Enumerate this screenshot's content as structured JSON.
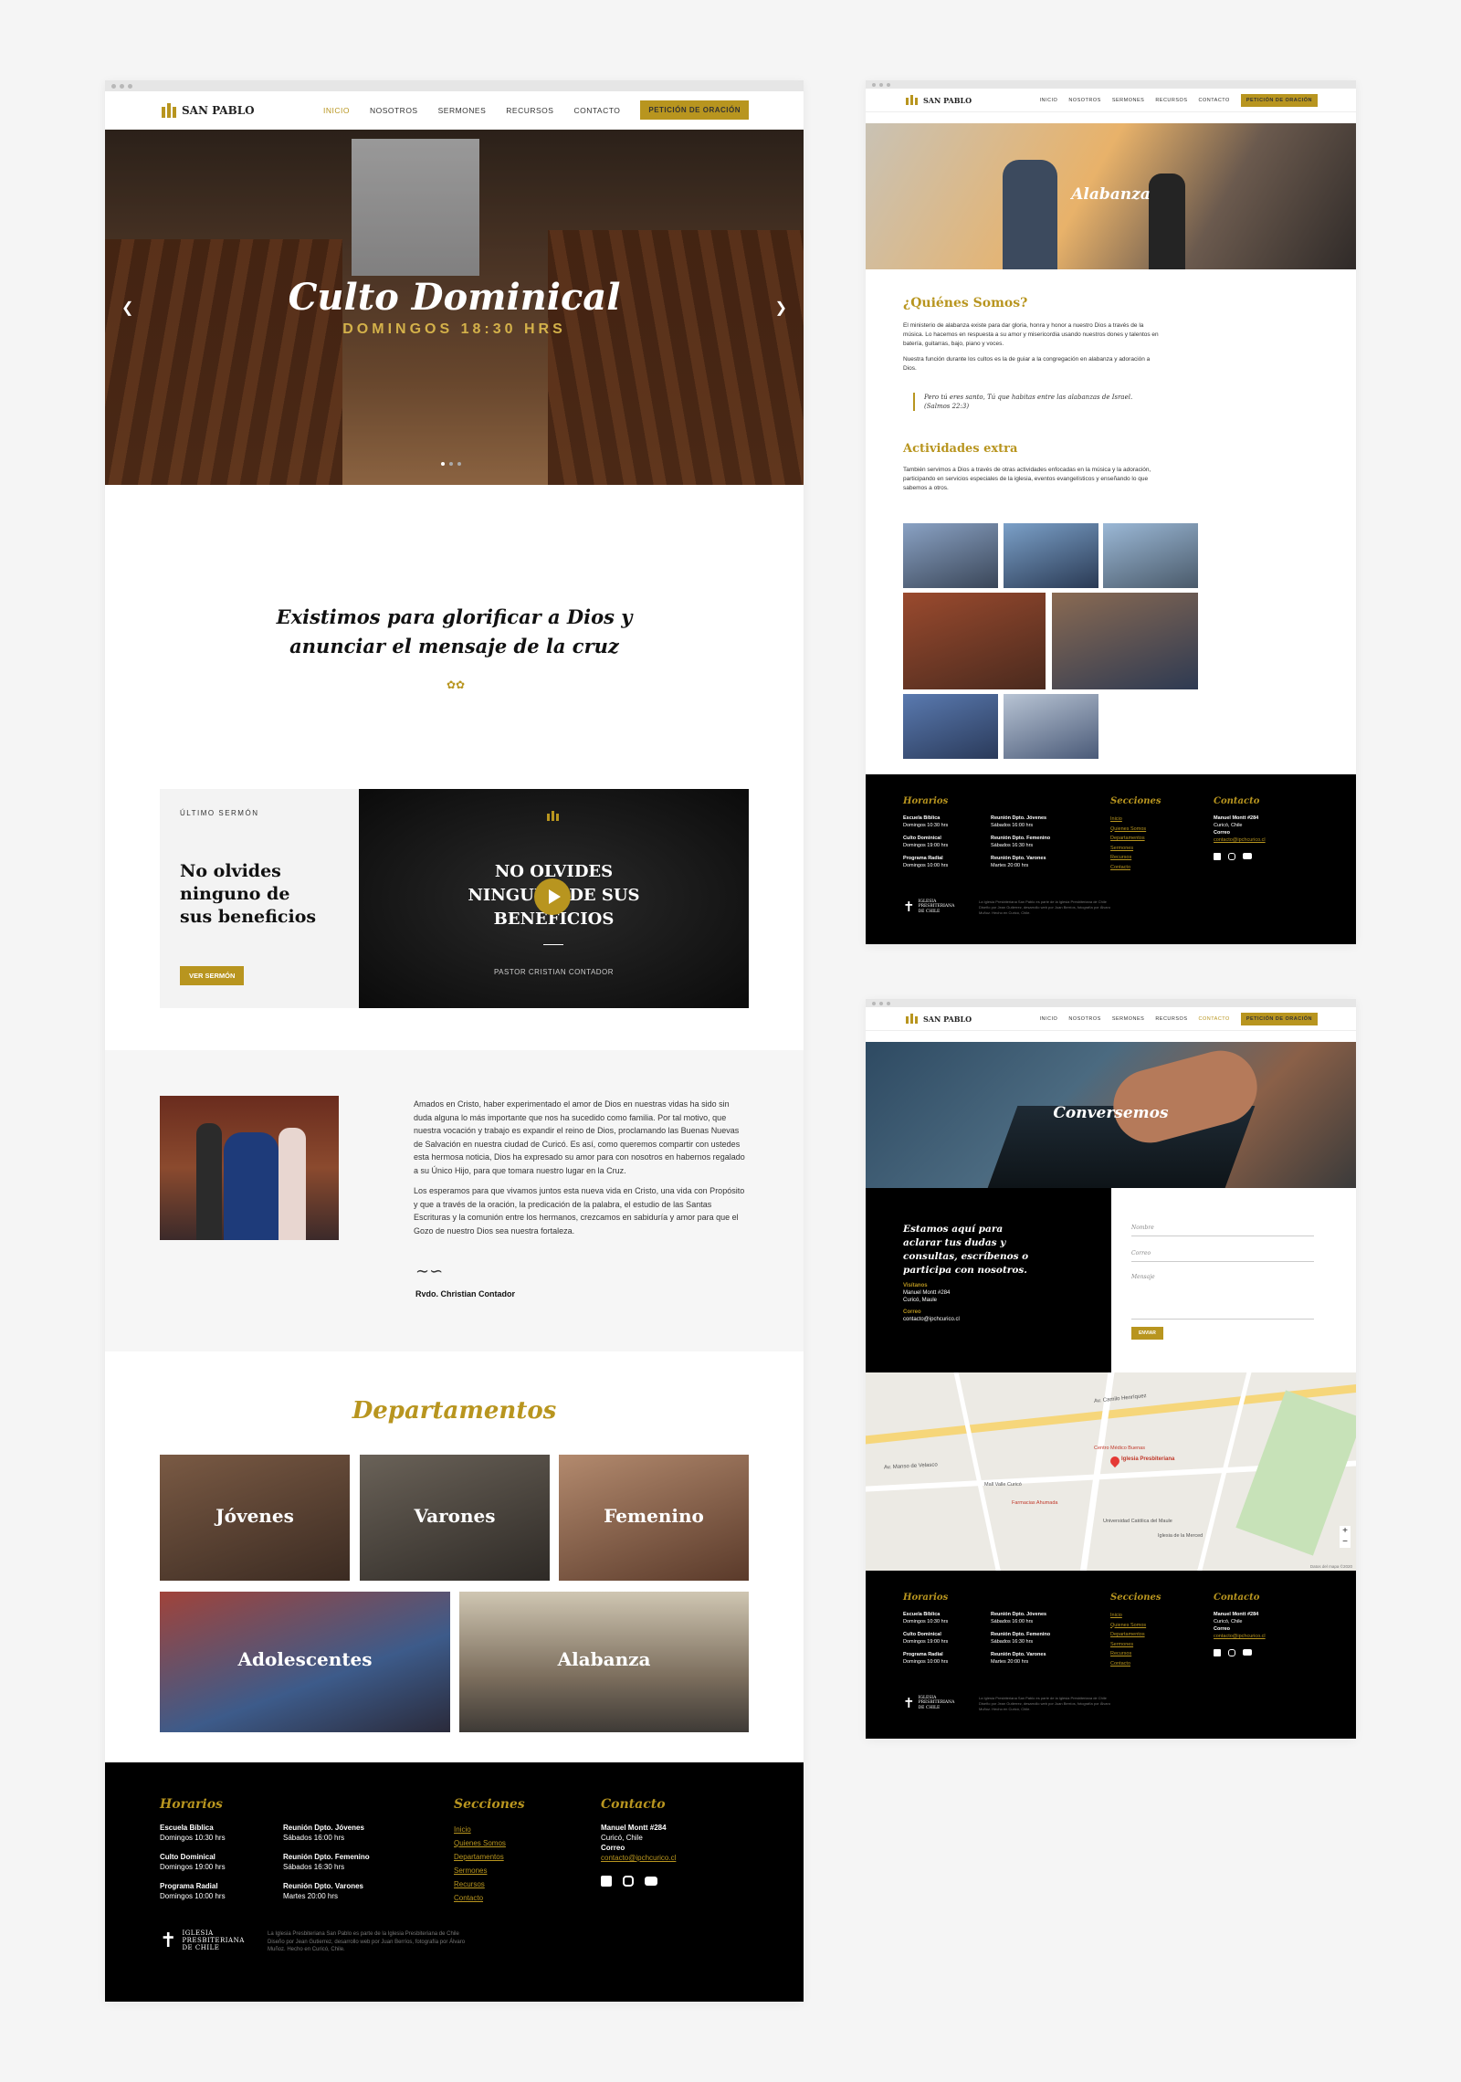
{
  "brand": {
    "name": "SAN PABLO",
    "gold": "#b8951f"
  },
  "nav": {
    "items": [
      "INICIO",
      "NOSOTROS",
      "SERMONES",
      "RECURSOS",
      "CONTACTO"
    ],
    "cta": "PETICIÓN DE ORACIÓN"
  },
  "home": {
    "hero": {
      "title": "Culto Dominical",
      "subtitle": "DOMINGOS 18:30 HRS"
    },
    "mission": {
      "line1": "Existimos para glorificar a Dios y",
      "line2": "anunciar el mensaje de la cruz"
    },
    "sermon": {
      "eyebrow": "ÚLTIMO SERMÓN",
      "title": "No olvides ninguno de sus beneficios",
      "button": "VER SERMÓN",
      "video_title_l1": "NO OLVIDES",
      "video_title_l2": "NINGUNO DE SUS",
      "video_title_l3": "BENEFICIOS",
      "video_caption": "PASTOR CRISTIAN CONTADOR"
    },
    "pastor": {
      "p1": "Amados en Cristo, haber experimentado el amor de Dios en nuestras vidas ha sido sin duda alguna lo más importante que nos ha sucedido como familia. Por tal motivo, que nuestra vocación y trabajo es expandir el reino de Dios, proclamando las Buenas Nuevas de Salvación en nuestra ciudad de Curicó. Es así, como queremos compartir con ustedes esta hermosa noticia, Dios ha expresado su amor para con nosotros en habernos regalado a su Único Hijo, para que tomara nuestro lugar en la Cruz.",
      "p2": "Los esperamos para que vivamos juntos esta nueva vida en Cristo, una vida con Propósito y que a través de la oración, la predicación de la palabra, el estudio de las Santas Escrituras y la comunión entre los hermanos, crezcamos en sabiduría y amor para que el Gozo de nuestro Dios sea nuestra fortaleza.",
      "signature": "Rvdo. Christian Contador"
    },
    "departments_title": "Departamentos",
    "departments": [
      "Jóvenes",
      "Varones",
      "Femenino",
      "Adolescentes",
      "Alabanza"
    ]
  },
  "footer": {
    "horarios_title": "Horarios",
    "schedule": [
      {
        "name": "Escuela Bíblica",
        "time": "Domingos 10:30 hrs"
      },
      {
        "name": "Culto Dominical",
        "time": "Domingos 19:00 hrs"
      },
      {
        "name": "Programa Radial",
        "time": "Domingos 10:00 hrs"
      },
      {
        "name": "Reunión Dpto. Jóvenes",
        "time": "Sábados 16:00 hrs"
      },
      {
        "name": "Reunión Dpto. Femenino",
        "time": "Sábados 16:30 hrs"
      },
      {
        "name": "Reunión Dpto. Varones",
        "time": "Martes 20:00 hrs"
      }
    ],
    "secciones_title": "Secciones",
    "sections": [
      "Inicio",
      "Quienes Somos",
      "Departamentos",
      "Sermones",
      "Recursos",
      "Contacto"
    ],
    "contacto_title": "Contacto",
    "address": "Manuel Montt #284",
    "city": "Curicó, Chile",
    "mail_label": "Correo",
    "mail": "contacto@ipchcurico.cl",
    "org_l1": "IGLESIA",
    "org_l2": "PRESBITERIANA",
    "org_l3": "DE CHILE",
    "credits_l1": "La Iglesia Presbiteriana San Pablo es parte de la Iglesia Presbiteriana de Chile",
    "credits_l2": "Diseño por Jean Gutierrez, desarrollo web por Juan Berríos, fotografía por Álvaro",
    "credits_l3": "Muñoz. Hecho en Curicó, Chile."
  },
  "alabanza": {
    "hero": "Alabanza",
    "about_title": "¿Quiénes Somos?",
    "about_p1": "El ministerio de alabanza existe para dar gloria, honra y honor a nuestro Dios a través de la música. Lo hacemos en respuesta a su amor y misericordia usando nuestros dones y talentos en batería, guitarras, bajo, piano y voces.",
    "about_p2": "Nuestra función durante los cultos es la de guiar a la congregación en alabanza y adoración a Dios.",
    "quote": "Pero tú eres santo, Tú que habitas entre las alabanzas de Israel. (Salmos 22:3)",
    "extra_title": "Actividades extra",
    "extra_p": "También servimos a Dios a través de otras actividades enfocadas en la música y la adoración, participando en servicios especiales de la iglesia, eventos evangelísticos y enseñando lo que sabemos a otros."
  },
  "contacto": {
    "hero": "Conversemos",
    "lead": "Estamos aquí para aclarar tus dudas y consultas, escríbenos o participa con nosotros.",
    "visit_label": "Visítanos",
    "visit_l1": "Manuel Montt #284",
    "visit_l2": "Curicó, Maule",
    "mail_label": "Correo",
    "mail": "contacto@ipchcurico.cl",
    "form": {
      "name": "Nombre",
      "email": "Correo",
      "message": "Mensaje",
      "send": "ENVIAR"
    },
    "map": {
      "road1": "Av. Camilo Henríquez",
      "road2": "Av. Manso de Velasco",
      "pin": "Iglesia Presbiteriana",
      "label1": "Centro Médico Buenas",
      "label2": "Mall Valle Curicó",
      "label3": "Universidad Católica del Maule",
      "label4": "Farmacias Ahumada",
      "label5": "Iglesia de la Merced",
      "zoom_in": "+",
      "zoom_out": "−",
      "attribution": "Datos del mapa ©2020"
    }
  }
}
